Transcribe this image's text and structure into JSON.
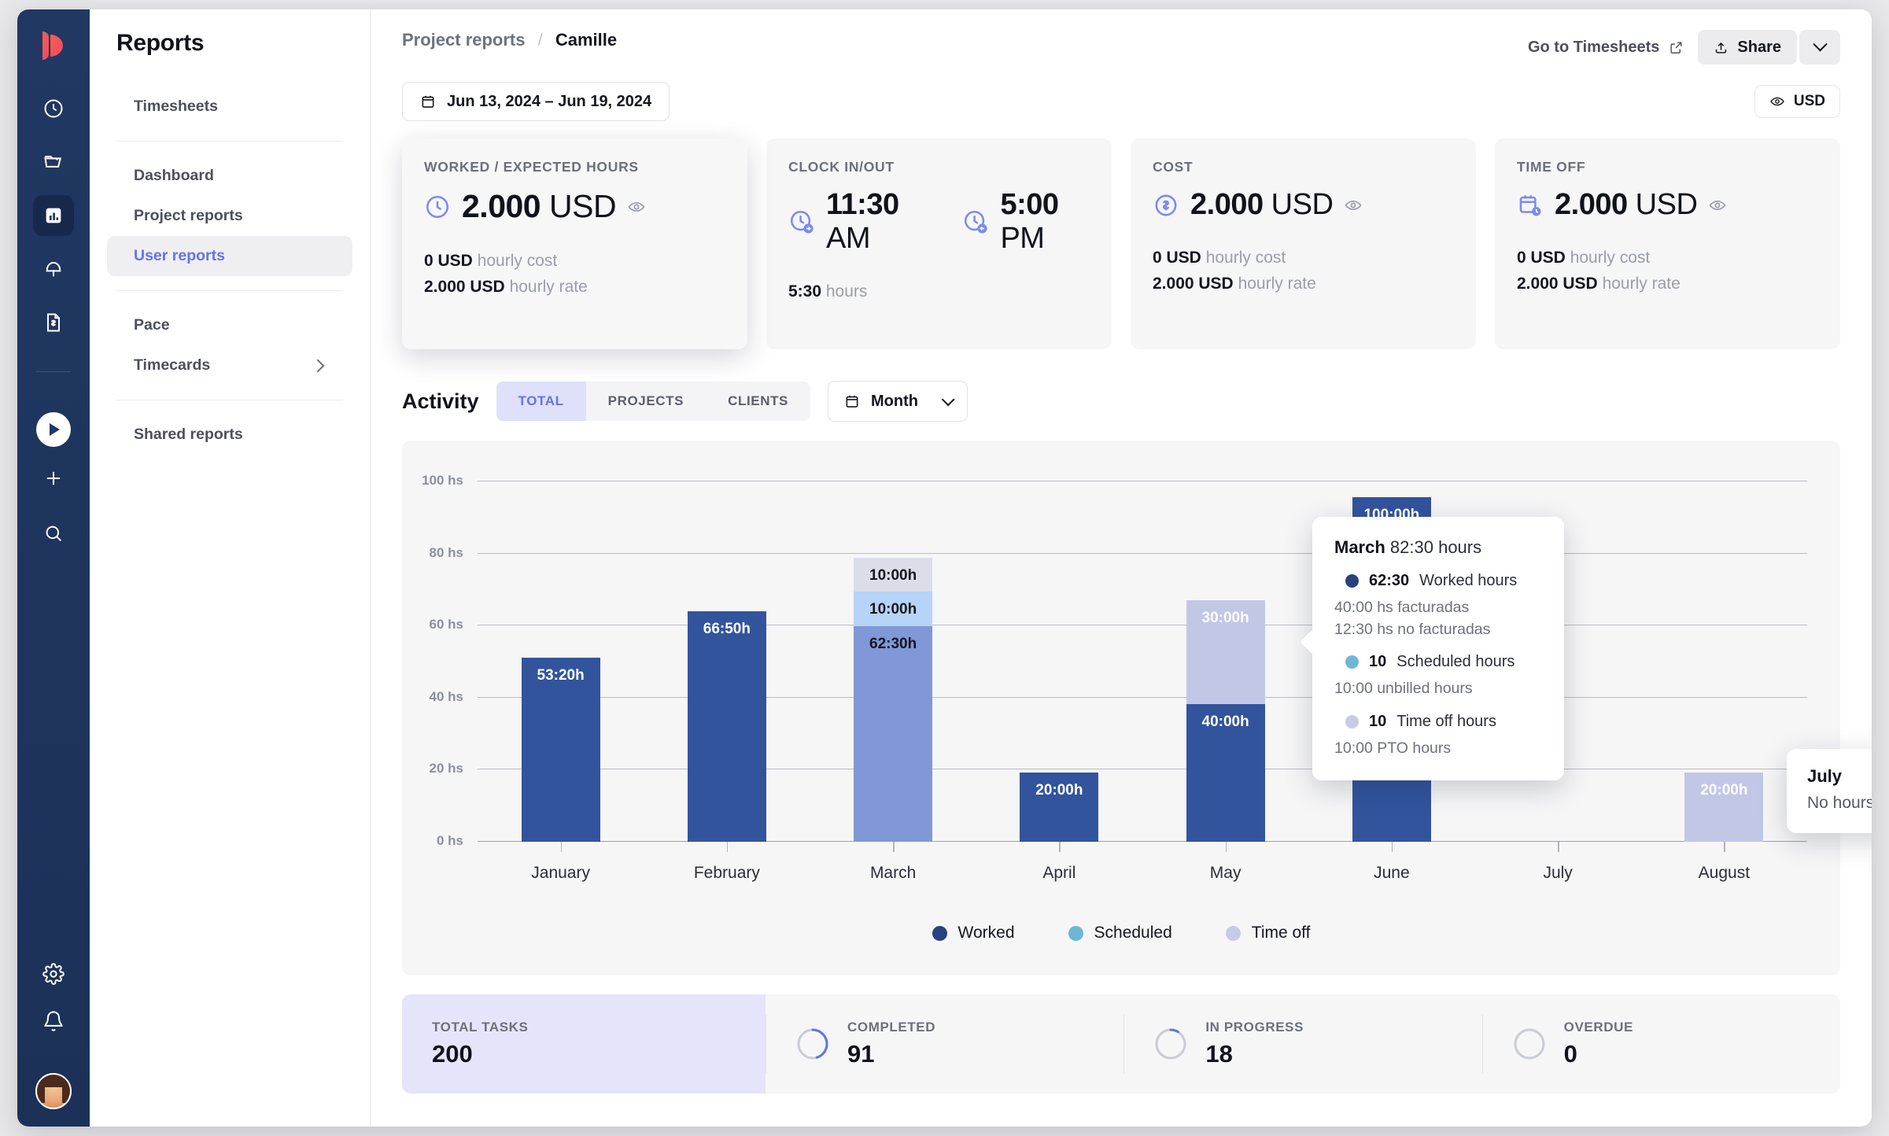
{
  "rail": {
    "icons": [
      {
        "name": "logo",
        "label": "Logo"
      },
      {
        "name": "clock-icon",
        "label": "Time tracker"
      },
      {
        "name": "folder-icon",
        "label": "Projects"
      },
      {
        "name": "chart-icon",
        "label": "Reports"
      },
      {
        "name": "beach-icon",
        "label": "Time off"
      },
      {
        "name": "invoice-icon",
        "label": "Invoices"
      },
      {
        "name": "play-button",
        "label": "Start timer"
      },
      {
        "name": "plus-icon",
        "label": "Add"
      },
      {
        "name": "search-icon",
        "label": "Search"
      },
      {
        "name": "gear-icon",
        "label": "Settings"
      },
      {
        "name": "bell-icon",
        "label": "Notifications"
      },
      {
        "name": "avatar",
        "label": "Account"
      }
    ]
  },
  "sidebar": {
    "title": "Reports",
    "group1": [
      {
        "label": "Timesheets",
        "active": false
      }
    ],
    "group2": [
      {
        "label": "Dashboard",
        "active": false
      },
      {
        "label": "Project reports",
        "active": false
      },
      {
        "label": "User reports",
        "active": true
      }
    ],
    "group3": [
      {
        "label": "Pace",
        "active": false,
        "chevron": false
      },
      {
        "label": "Timecards",
        "active": false,
        "chevron": true
      }
    ],
    "group4": [
      {
        "label": "Shared reports",
        "active": false
      }
    ]
  },
  "header": {
    "breadcrumb_parent": "Project reports",
    "breadcrumb_sep": "/",
    "breadcrumb_current": "Camille",
    "go_to_timesheets": "Go to Timesheets",
    "share_label": "Share",
    "date_range": "Jun 13, 2024 – Jun 19, 2024",
    "currency_label": "USD"
  },
  "cards": [
    {
      "label": "WORKED / EXPECTED HOURS",
      "icon": "clock-icon",
      "value": "2.000",
      "unit": "USD",
      "has_eye": true,
      "sub": [
        {
          "value": "0 USD",
          "label": "hourly cost"
        },
        {
          "value": "2.000 USD",
          "label": "hourly rate"
        }
      ],
      "highlighted": true
    },
    {
      "label": "CLOCK IN/OUT",
      "icon": "clock-in-icon",
      "value_in": "11:30",
      "unit_in": "AM",
      "value_out": "5:00",
      "unit_out": "PM",
      "has_eye": false,
      "sub": [
        {
          "value": "5:30",
          "label": "hours"
        }
      ],
      "highlighted": false
    },
    {
      "label": "COST",
      "icon": "dollar-icon",
      "value": "2.000",
      "unit": "USD",
      "has_eye": true,
      "sub": [
        {
          "value": "0 USD",
          "label": "hourly cost"
        },
        {
          "value": "2.000 USD",
          "label": "hourly rate"
        }
      ],
      "highlighted": false
    },
    {
      "label": "TIME OFF",
      "icon": "calendar-clock-icon",
      "value": "2.000",
      "unit": "USD",
      "has_eye": true,
      "sub": [
        {
          "value": "0 USD",
          "label": "hourly cost"
        },
        {
          "value": "2.000 USD",
          "label": "hourly rate"
        }
      ],
      "highlighted": false
    }
  ],
  "activity": {
    "title": "Activity",
    "tabs": [
      {
        "label": "TOTAL",
        "active": true
      },
      {
        "label": "PROJECTS",
        "active": false
      },
      {
        "label": "CLIENTS",
        "active": false
      }
    ],
    "grouping": "Month"
  },
  "chart_data": {
    "type": "bar",
    "title": "Activity",
    "stacked": true,
    "xlabel": "",
    "ylabel": "",
    "ylim": [
      0,
      100
    ],
    "ytick_labels": [
      "100 hs",
      "80 hs",
      "60 hs",
      "40 hs",
      "20 hs",
      "0 hs"
    ],
    "ytick_values": [
      100,
      80,
      60,
      40,
      20,
      0
    ],
    "grid": true,
    "legend_position": "bottom",
    "categories": [
      "January",
      "February",
      "March",
      "April",
      "May",
      "June",
      "July",
      "August"
    ],
    "series": [
      {
        "name": "Worked",
        "color": "#32549d",
        "values": [
          53.33,
          66.83,
          62.5,
          20,
          40,
          100,
          0,
          0
        ],
        "labels": [
          "53:20h",
          "66:50h",
          "62:30h",
          "20:00h",
          "40:00h",
          "100:00h",
          "",
          ""
        ]
      },
      {
        "name": "Scheduled",
        "color": "#6fb6d6",
        "values": [
          0,
          0,
          10,
          0,
          0,
          0,
          0,
          0
        ],
        "labels": [
          "",
          "",
          "10:00h",
          "",
          "",
          "",
          "",
          ""
        ]
      },
      {
        "name": "Time off",
        "color": "#c3c7e6",
        "values": [
          0,
          0,
          10,
          0,
          30,
          0,
          0,
          20
        ],
        "labels": [
          "",
          "",
          "10:00h",
          "",
          "30:00h",
          "",
          "",
          "20:00h"
        ]
      }
    ],
    "legend": [
      "Worked",
      "Scheduled",
      "Time off"
    ],
    "hovered_category": "March"
  },
  "tooltip_march": {
    "month": "March",
    "total": "82:30 hours",
    "rows": [
      {
        "color": "#27427e",
        "value": "62:30",
        "label": "Worked hours",
        "sub": [
          "40:00 hs facturadas",
          "12:30 hs no facturadas"
        ]
      },
      {
        "color": "#6fb6d6",
        "value": "10",
        "label": "Scheduled hours",
        "sub": [
          "10:00 unbilled hours"
        ]
      },
      {
        "color": "#c3c7e6",
        "value": "10",
        "label": "Time off hours",
        "sub": [
          "10:00 PTO hours"
        ]
      }
    ]
  },
  "tooltip_july": {
    "month": "July",
    "message": "No hours registered"
  },
  "tasks": [
    {
      "label": "TOTAL TASKS",
      "value": "200",
      "ring": false,
      "highlight": true,
      "percent": 100
    },
    {
      "label": "COMPLETED",
      "value": "91",
      "ring": true,
      "highlight": false,
      "percent": 45
    },
    {
      "label": "IN PROGRESS",
      "value": "18",
      "ring": true,
      "highlight": false,
      "percent": 9
    },
    {
      "label": "OVERDUE",
      "value": "0",
      "ring": true,
      "highlight": false,
      "percent": 0
    }
  ],
  "colors": {
    "accent": "#6272f0",
    "worked": "#32549d",
    "scheduled": "#6fb6d6",
    "timeoff": "#c3c7e6",
    "rail": "#1e3561"
  }
}
